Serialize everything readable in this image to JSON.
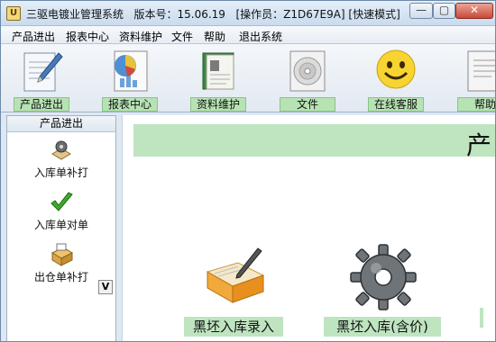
{
  "window": {
    "title": "三驱电镀业管理系统",
    "version": "版本号：15.06.19",
    "operator": "[操作员：Z1D67E9A]",
    "mode": "[快速模式]"
  },
  "window_controls": {
    "minimize": "—",
    "maximize": "▢",
    "close": "✕"
  },
  "menu": {
    "items": [
      "产品进出",
      "报表中心",
      "资料维护",
      "文件",
      "帮助",
      "退出系统"
    ]
  },
  "toolbar": {
    "items": [
      {
        "label": "产品进出",
        "icon": "pen-document-icon"
      },
      {
        "label": "报表中心",
        "icon": "pie-chart-report-icon"
      },
      {
        "label": "资料维护",
        "icon": "book-icon"
      },
      {
        "label": "文件",
        "icon": "cd-disc-icon"
      },
      {
        "label": "在线客服",
        "icon": "smiley-face-icon"
      },
      {
        "label": "帮助",
        "icon": "help-document-icon"
      }
    ]
  },
  "sidebar": {
    "header": "产品进出",
    "items": [
      {
        "label": "入库单补打",
        "icon": "gear-stamp-icon"
      },
      {
        "label": "入库单对单",
        "icon": "checkmark-icon"
      },
      {
        "label": "出仓单补打",
        "icon": "printer-box-icon"
      }
    ],
    "scroll_button": "V"
  },
  "content": {
    "title": "产",
    "actions": [
      {
        "label": "黑坯入库录入",
        "icon": "folder-pen-icon"
      },
      {
        "label": "黑坯入库(含价)",
        "icon": "gear-icon"
      }
    ]
  },
  "colors": {
    "label_green": "#b7e3b4",
    "window_bg": "#dfe8f1",
    "close_red": "#c9493a"
  }
}
